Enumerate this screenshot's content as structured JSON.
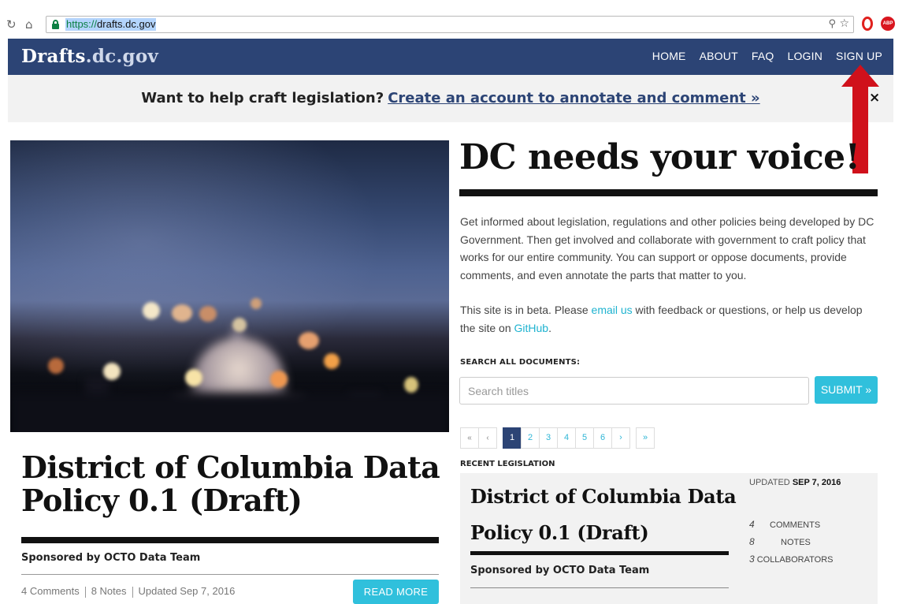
{
  "browser": {
    "url_scheme": "https://",
    "url_host": "drafts.dc.gov",
    "reload_icon": "reload-icon",
    "home_icon": "home-icon"
  },
  "header": {
    "logo_main": "Drafts",
    "logo_tld": ".dc.gov",
    "nav": [
      "HOME",
      "ABOUT",
      "FAQ",
      "LOGIN",
      "SIGN UP"
    ],
    "brand_color": "#2c4475"
  },
  "banner": {
    "text": "Want to help craft legislation?",
    "link": "Create an account to annotate and comment »",
    "close": "×"
  },
  "annotation": {
    "arrow_color": "#d0111b"
  },
  "hero": {
    "heading": "DC needs your voice!",
    "intro": "Get informed about legislation, regulations and other policies being developed by DC Government. Then get involved and collaborate with government to craft policy that works for our entire community. You can support or oppose documents, provide comments, and even annotate the parts that matter to you.",
    "beta_pre": "This site is in beta. Please ",
    "beta_email": "email us",
    "beta_mid": " with feedback or questions, or help us develop the site on ",
    "beta_github": "GitHub",
    "beta_end": "."
  },
  "search": {
    "label": "SEARCH ALL DOCUMENTS:",
    "placeholder": "Search titles",
    "submit": "SUBMIT »"
  },
  "pager": {
    "first": "«",
    "prev": "‹",
    "pages": [
      "1",
      "2",
      "3",
      "4",
      "5",
      "6"
    ],
    "next": "›",
    "last": "»",
    "active": "1"
  },
  "recent": {
    "label": "RECENT LEGISLATION",
    "card": {
      "title": "District of Columbia Data Policy 0.1 (Draft)",
      "sponsor": "Sponsored by OCTO Data Team",
      "updated_label": "UPDATED",
      "updated_date": "SEP 7, 2016",
      "stats": [
        {
          "num": "4",
          "label": "COMMENTS"
        },
        {
          "num": "8",
          "label": "NOTES"
        },
        {
          "num": "3",
          "label": "COLLABORATORS"
        }
      ]
    }
  },
  "featured": {
    "title": "District of Columbia Data Policy 0.1 (Draft)",
    "sponsor": "Sponsored by OCTO Data Team",
    "meta_comments": "4 Comments",
    "meta_notes": "8 Notes",
    "meta_updated": "Updated Sep 7, 2016",
    "read_more": "READ MORE"
  },
  "accent_color": "#30c0dc"
}
